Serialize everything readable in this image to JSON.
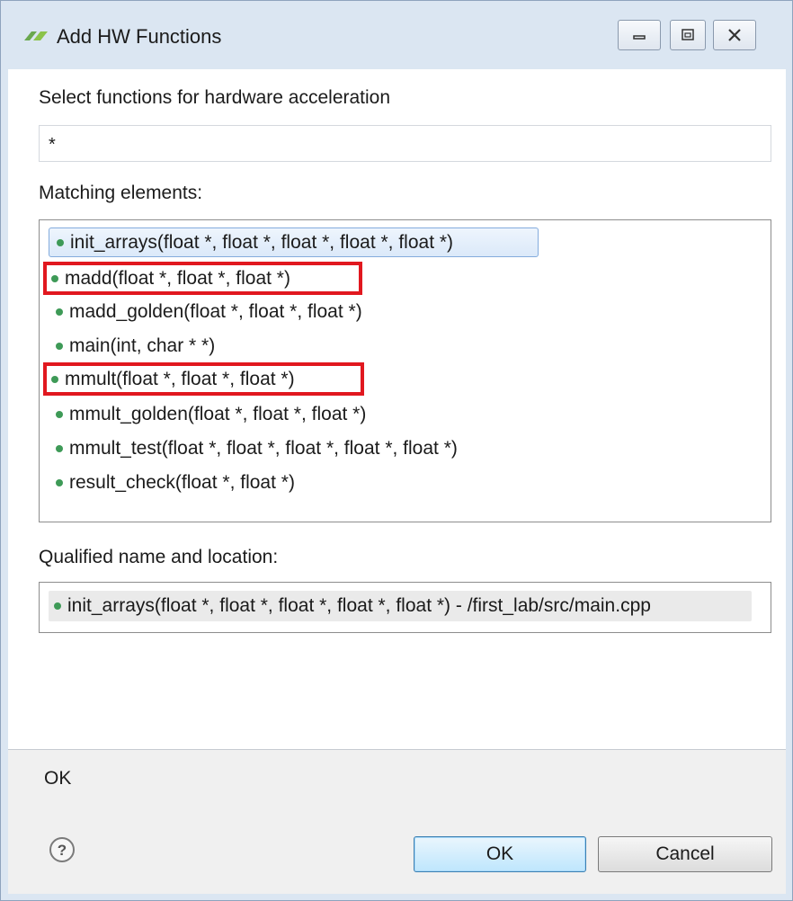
{
  "window": {
    "title": "Add HW Functions",
    "controls": {
      "minimize": "minimize-icon",
      "maximize": "maximize-icon",
      "close": "close-icon"
    }
  },
  "dialog": {
    "prompt": "Select functions for hardware acceleration",
    "filter_value": "*",
    "matching_label": "Matching elements:",
    "items": [
      {
        "label": "init_arrays(float *, float *, float *, float *, float *)",
        "selected": true,
        "highlighted": false
      },
      {
        "label": "madd(float *, float *, float *)",
        "selected": false,
        "highlighted": true
      },
      {
        "label": "madd_golden(float *, float *, float *)",
        "selected": false,
        "highlighted": false
      },
      {
        "label": "main(int, char * *)",
        "selected": false,
        "highlighted": false
      },
      {
        "label": "mmult(float *, float *, float *)",
        "selected": false,
        "highlighted": true
      },
      {
        "label": "mmult_golden(float *, float *, float *)",
        "selected": false,
        "highlighted": false
      },
      {
        "label": "mmult_test(float *, float *, float *, float *, float *)",
        "selected": false,
        "highlighted": false
      },
      {
        "label": "result_check(float *, float *)",
        "selected": false,
        "highlighted": false
      }
    ],
    "qualified_label": "Qualified name and location:",
    "qualified_value": "init_arrays(float *, float *, float *, float *, float *) - /first_lab/src/main.cpp",
    "status": "OK",
    "ok_label": "OK",
    "cancel_label": "Cancel"
  },
  "colors": {
    "function_dot": "#3e9a57",
    "highlight_border": "#e1181f",
    "selection_border": "#84acdd",
    "titlebar_bg": "#dbe6f2"
  }
}
